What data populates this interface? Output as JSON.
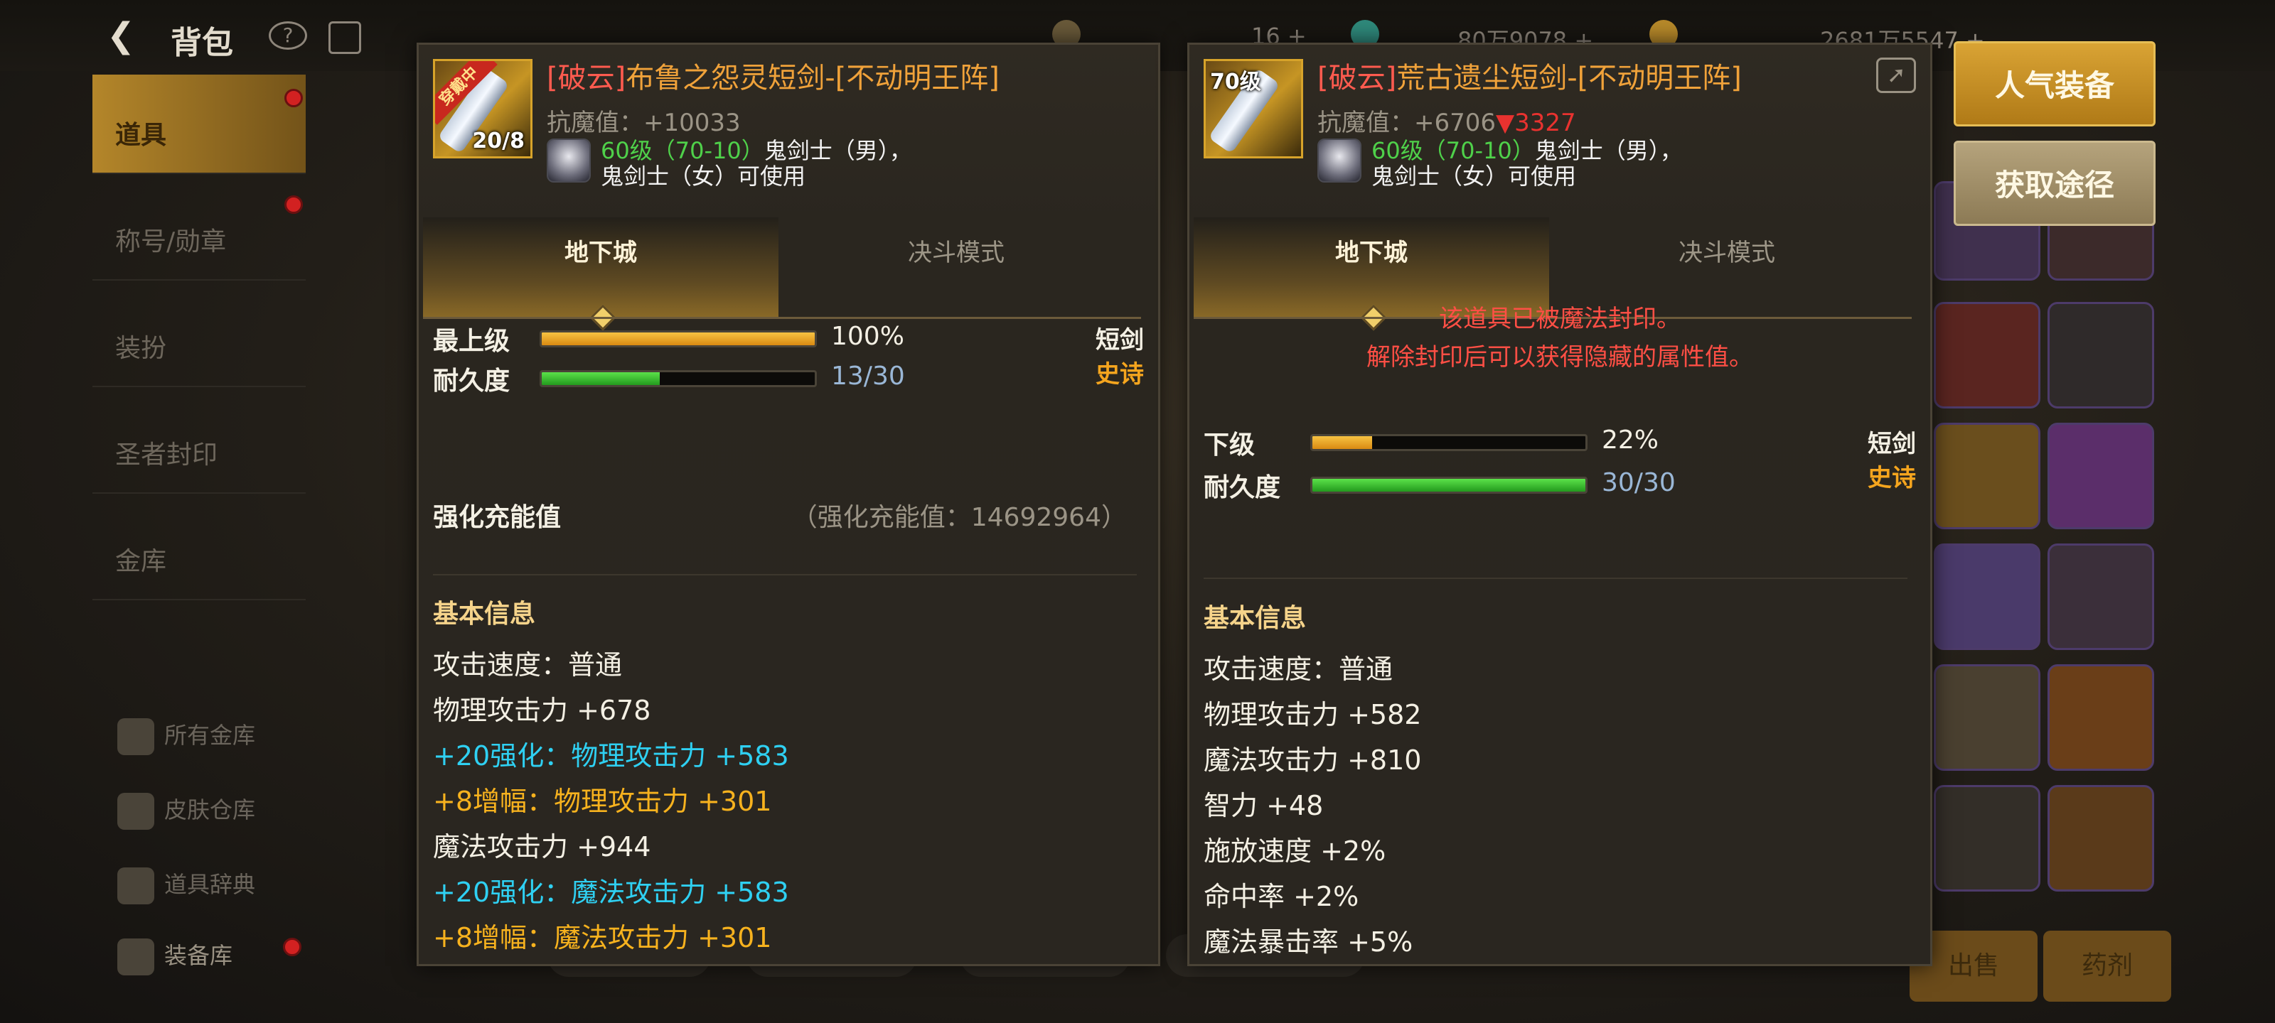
{
  "background": {
    "title": "背包",
    "sidebar_items": [
      "道具",
      "称号/勋章",
      "装扮",
      "圣者封印",
      "金库"
    ],
    "lower_items": [
      "所有金库",
      "皮肤仓库",
      "道具辞典",
      "装备库"
    ],
    "resources": [
      "16 +",
      "80万9078 +",
      "2681万5547 +"
    ],
    "bottom_buttons": [
      "出售",
      "药剂"
    ]
  },
  "left_item": {
    "name_prefix": "[破云]",
    "name": "布鲁之怨灵短剑-[不动明王阵]",
    "equipped_ribbon": "穿戴中",
    "count": "20/8",
    "resist": "抗魔值：+10033",
    "req_level": "60级（70-10）",
    "req_class1": "鬼剑士（男），",
    "req_class2": "鬼剑士（女）可使用",
    "tabs": [
      "地下城",
      "决斗模式"
    ],
    "grade_label": "最上级",
    "grade_value": "100%",
    "grade_fill": 1.0,
    "durability_label": "耐久度",
    "durability_value": "13/30",
    "durability_fill": 0.433,
    "type": "短剑",
    "rarity": "史诗",
    "charge_label": "强化充能值",
    "charge_value": "（强化充能值：14692964）",
    "basic_info_title": "基本信息",
    "attrs": [
      {
        "text": "攻击速度：普通",
        "color": "white"
      },
      {
        "text": "物理攻击力 +678",
        "color": "white"
      },
      {
        "text": "+20强化：物理攻击力 +583",
        "color": "cyan"
      },
      {
        "text": " +8增幅：物理攻击力 +301",
        "color": "orange"
      },
      {
        "text": "魔法攻击力 +944",
        "color": "white"
      },
      {
        "text": "+20强化：魔法攻击力 +583",
        "color": "cyan"
      },
      {
        "text": " +8增幅：魔法攻击力 +301",
        "color": "orange"
      }
    ]
  },
  "right_item": {
    "name_prefix": "[破云]",
    "name": "荒古遗尘短剑-[不动明王阵]",
    "level_badge": "70级",
    "resist": "抗魔值：+6706",
    "resist_diff": "▼3327",
    "req_level": "60级（70-10）",
    "req_class1": "鬼剑士（男），",
    "req_class2": "鬼剑士（女）可使用",
    "tabs": [
      "地下城",
      "决斗模式"
    ],
    "sealed_line1": "该道具已被魔法封印。",
    "sealed_line2": "解除封印后可以获得隐藏的属性值。",
    "grade_label": "下级",
    "grade_value": "22%",
    "grade_fill": 0.22,
    "durability_label": "耐久度",
    "durability_value": "30/30",
    "durability_fill": 1.0,
    "type": "短剑",
    "rarity": "史诗",
    "basic_info_title": "基本信息",
    "attrs": [
      {
        "text": "攻击速度：普通",
        "color": "white"
      },
      {
        "text": "物理攻击力 +582",
        "color": "white"
      },
      {
        "text": "魔法攻击力 +810",
        "color": "white"
      },
      {
        "text": "智力 +48",
        "color": "white"
      },
      {
        "text": "施放速度 +2%",
        "color": "white"
      },
      {
        "text": "命中率 +2%",
        "color": "white"
      },
      {
        "text": "魔法暴击率 +5%",
        "color": "white"
      }
    ]
  },
  "side_buttons": {
    "popular": "人气装备",
    "source": "获取途径"
  },
  "colors": {
    "name_prefix": "#ff5b4f",
    "name": "#f0a23a",
    "enhance": "#2fd0f2",
    "amplify": "#f7b21e",
    "sealed": "#ff4f45"
  }
}
